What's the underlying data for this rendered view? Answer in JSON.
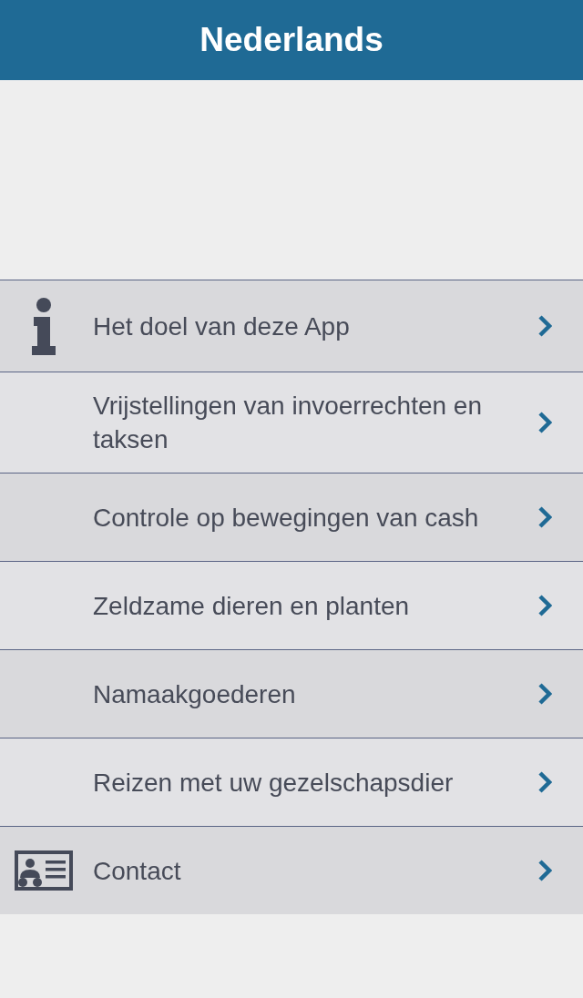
{
  "header": {
    "title": "Nederlands"
  },
  "menu": [
    {
      "kind": "info",
      "label": "Het doel van deze App"
    },
    {
      "kind": "plain",
      "label": "Vrijstellingen van invoerrechten en taksen"
    },
    {
      "kind": "plain",
      "label": "Controle op bewegingen van cash"
    },
    {
      "kind": "plain",
      "label": "Zeldzame dieren en planten"
    },
    {
      "kind": "plain",
      "label": "Namaakgoederen"
    },
    {
      "kind": "plain",
      "label": "Reizen met uw gezelschapsdier"
    },
    {
      "kind": "contact",
      "label": "Contact"
    }
  ]
}
